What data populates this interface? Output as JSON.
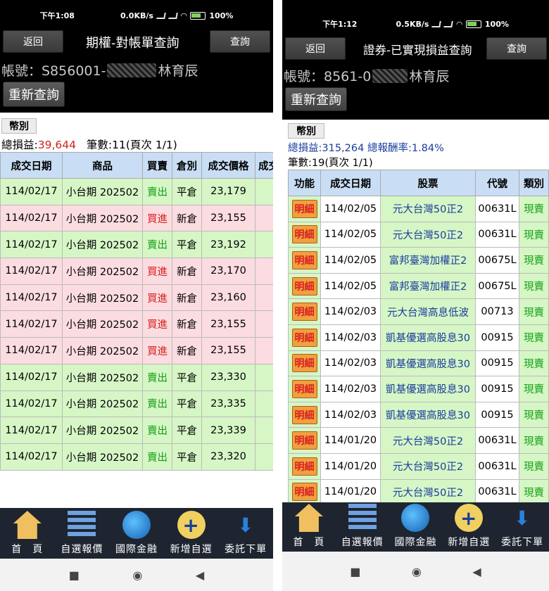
{
  "left": {
    "status": {
      "time": "下午1:08",
      "speed": "0.0KB/s",
      "battery": "100%"
    },
    "topbar": {
      "back": "返回",
      "title": "期權-對帳單查詢",
      "query": "查詢"
    },
    "account": {
      "prefix": "帳號：S856001-",
      "name": "林育辰"
    },
    "requery": "重新查詢",
    "currency": "幣別",
    "summary": {
      "label": "總損益:",
      "value": "39,644",
      "count": "筆數:11(頁次 1/1)"
    },
    "columns": [
      "成交日期",
      "商品",
      "買賣",
      "倉別",
      "成交價格",
      "成交"
    ],
    "rows": [
      {
        "date": "114/02/17",
        "product": "小台期 202502",
        "side": "賣出",
        "pos": "平倉",
        "price": "23,179"
      },
      {
        "date": "114/02/17",
        "product": "小台期 202502",
        "side": "買進",
        "pos": "新倉",
        "price": "23,155"
      },
      {
        "date": "114/02/17",
        "product": "小台期 202502",
        "side": "賣出",
        "pos": "平倉",
        "price": "23,192"
      },
      {
        "date": "114/02/17",
        "product": "小台期 202502",
        "side": "買進",
        "pos": "新倉",
        "price": "23,170"
      },
      {
        "date": "114/02/17",
        "product": "小台期 202502",
        "side": "買進",
        "pos": "新倉",
        "price": "23,160"
      },
      {
        "date": "114/02/17",
        "product": "小台期 202502",
        "side": "買進",
        "pos": "新倉",
        "price": "23,155"
      },
      {
        "date": "114/02/17",
        "product": "小台期 202502",
        "side": "買進",
        "pos": "新倉",
        "price": "23,155"
      },
      {
        "date": "114/02/17",
        "product": "小台期 202502",
        "side": "賣出",
        "pos": "平倉",
        "price": "23,330"
      },
      {
        "date": "114/02/17",
        "product": "小台期 202502",
        "side": "賣出",
        "pos": "平倉",
        "price": "23,335"
      },
      {
        "date": "114/02/17",
        "product": "小台期 202502",
        "side": "賣出",
        "pos": "平倉",
        "price": "23,339"
      },
      {
        "date": "114/02/17",
        "product": "小台期 202502",
        "side": "賣出",
        "pos": "平倉",
        "price": "23,320"
      }
    ]
  },
  "right": {
    "status": {
      "time": "下午1:12",
      "speed": "0.5KB/s",
      "battery": "100%"
    },
    "topbar": {
      "back": "返回",
      "title": "證券-已實現損益查詢",
      "query": "查詢"
    },
    "account": {
      "prefix": "帳號：8561-0",
      "name": "林育辰"
    },
    "requery": "重新查詢",
    "currency": "幣別",
    "summary": {
      "line1": "總損益:315,264 總報酬率:1.84%",
      "line2": "筆數:19(頁次 1/1)"
    },
    "columns": [
      "功能",
      "成交日期",
      "股票",
      "代號",
      "類別"
    ],
    "detail": "明細",
    "rows": [
      {
        "date": "114/02/05",
        "stock": "元大台灣50正2",
        "code": "00631L",
        "type": "現賣"
      },
      {
        "date": "114/02/05",
        "stock": "元大台灣50正2",
        "code": "00631L",
        "type": "現賣"
      },
      {
        "date": "114/02/05",
        "stock": "富邦臺灣加權正2",
        "code": "00675L",
        "type": "現賣"
      },
      {
        "date": "114/02/05",
        "stock": "富邦臺灣加權正2",
        "code": "00675L",
        "type": "現賣"
      },
      {
        "date": "114/02/03",
        "stock": "元大台灣高息低波",
        "code": "00713",
        "type": "現賣"
      },
      {
        "date": "114/02/03",
        "stock": "凱基優選高股息30",
        "code": "00915",
        "type": "現賣"
      },
      {
        "date": "114/02/03",
        "stock": "凱基優選高股息30",
        "code": "00915",
        "type": "現賣"
      },
      {
        "date": "114/02/03",
        "stock": "凱基優選高股息30",
        "code": "00915",
        "type": "現賣"
      },
      {
        "date": "114/02/03",
        "stock": "凱基優選高股息30",
        "code": "00915",
        "type": "現賣"
      },
      {
        "date": "114/01/20",
        "stock": "元大台灣50正2",
        "code": "00631L",
        "type": "現賣"
      },
      {
        "date": "114/01/20",
        "stock": "元大台灣50正2",
        "code": "00631L",
        "type": "現賣"
      },
      {
        "date": "114/01/20",
        "stock": "元大台灣50正2",
        "code": "00631L",
        "type": "現賣"
      }
    ]
  },
  "nav": [
    {
      "label": "首　頁",
      "icon": "home-icon"
    },
    {
      "label": "自選報價",
      "icon": "watchlist-icon"
    },
    {
      "label": "國際金融",
      "icon": "globe-icon"
    },
    {
      "label": "新增自選",
      "icon": "add-icon"
    },
    {
      "label": "委託下單",
      "icon": "order-download-icon"
    }
  ],
  "colors": {
    "buy": "#d82020",
    "sell": "#14a014",
    "header": "#c9def5",
    "row_green": "#d6f6c6",
    "row_pink": "#fbdce0"
  }
}
